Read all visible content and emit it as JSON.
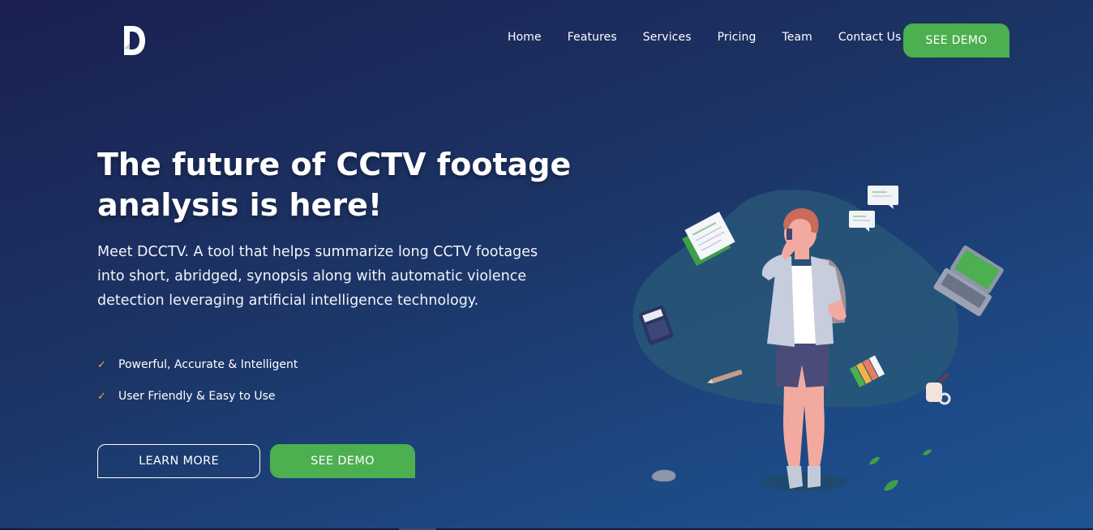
{
  "brand": {
    "logo_letter": "D",
    "logo_color": "#ffffff"
  },
  "nav": {
    "items": [
      {
        "label": "Home"
      },
      {
        "label": "Features"
      },
      {
        "label": "Services"
      },
      {
        "label": "Pricing"
      },
      {
        "label": "Team"
      },
      {
        "label": "Contact Us"
      }
    ],
    "cta_label": "SEE DEMO"
  },
  "hero": {
    "title": "The future of CCTV footage analysis is here!",
    "description": "Meet DCCTV. A tool that helps summarize long CCTV footages into short, abridged, synopsis along with automatic violence detection leveraging artificial intelligence technology.",
    "features": [
      {
        "icon": "check-icon",
        "label": "Powerful, Accurate & Intelligent"
      },
      {
        "icon": "check-icon",
        "label": "User Friendly & Easy to Use"
      }
    ],
    "learn_more_label": "LEARN MORE",
    "see_demo_label": "SEE DEMO"
  },
  "colors": {
    "accent_green": "#4caf50",
    "check_orange": "#f0a642",
    "bg_dark": "#1a2050",
    "bg_light": "#1f5391"
  }
}
